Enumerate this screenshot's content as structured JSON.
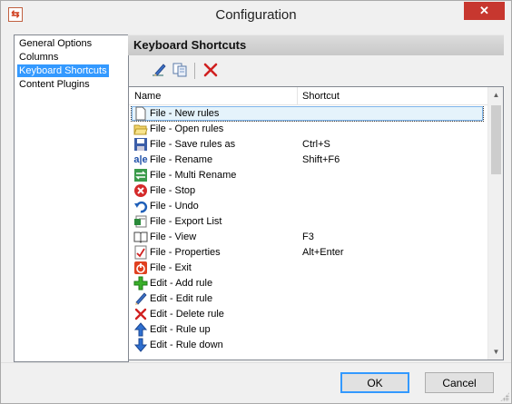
{
  "window": {
    "title": "Configuration",
    "close_glyph": "✕"
  },
  "nav": {
    "items": [
      {
        "label": "General Options",
        "selected": false
      },
      {
        "label": "Columns",
        "selected": false
      },
      {
        "label": "Keyboard Shortcuts",
        "selected": true
      },
      {
        "label": "Content Plugins",
        "selected": false
      }
    ]
  },
  "panel": {
    "title": "Keyboard Shortcuts"
  },
  "toolbar": {
    "buttons": [
      {
        "name": "edit-shortcut",
        "icon": "pencil-icon"
      },
      {
        "name": "copy-shortcut",
        "icon": "copy-icon"
      },
      {
        "name": "delete-shortcut",
        "icon": "delete-icon"
      }
    ]
  },
  "list": {
    "columns": {
      "name": "Name",
      "shortcut": "Shortcut"
    },
    "rows": [
      {
        "name": "File - New rules",
        "shortcut": "",
        "icon": "new-file-icon",
        "selected": true
      },
      {
        "name": "File - Open rules",
        "shortcut": "",
        "icon": "open-folder-icon"
      },
      {
        "name": "File - Save rules as",
        "shortcut": "Ctrl+S",
        "icon": "save-icon"
      },
      {
        "name": "File - Rename",
        "shortcut": "Shift+F6",
        "icon": "rename-icon"
      },
      {
        "name": "File - Multi Rename",
        "shortcut": "",
        "icon": "multi-rename-icon"
      },
      {
        "name": "File - Stop",
        "shortcut": "",
        "icon": "stop-icon"
      },
      {
        "name": "File - Undo",
        "shortcut": "",
        "icon": "undo-icon"
      },
      {
        "name": "File - Export List",
        "shortcut": "",
        "icon": "export-list-icon"
      },
      {
        "name": "File - View",
        "shortcut": "F3",
        "icon": "view-icon"
      },
      {
        "name": "File - Properties",
        "shortcut": "Alt+Enter",
        "icon": "properties-icon"
      },
      {
        "name": "File - Exit",
        "shortcut": "",
        "icon": "exit-icon"
      },
      {
        "name": "Edit - Add rule",
        "shortcut": "",
        "icon": "add-icon"
      },
      {
        "name": "Edit - Edit rule",
        "shortcut": "",
        "icon": "pencil-icon"
      },
      {
        "name": "Edit - Delete rule",
        "shortcut": "",
        "icon": "delete-icon"
      },
      {
        "name": "Edit - Rule up",
        "shortcut": "",
        "icon": "arrow-up-icon"
      },
      {
        "name": "Edit - Rule down",
        "shortcut": "",
        "icon": "arrow-down-icon"
      }
    ]
  },
  "buttons": {
    "ok": "OK",
    "cancel": "Cancel"
  },
  "colors": {
    "selection": "#3399ff",
    "close": "#c7372f"
  }
}
